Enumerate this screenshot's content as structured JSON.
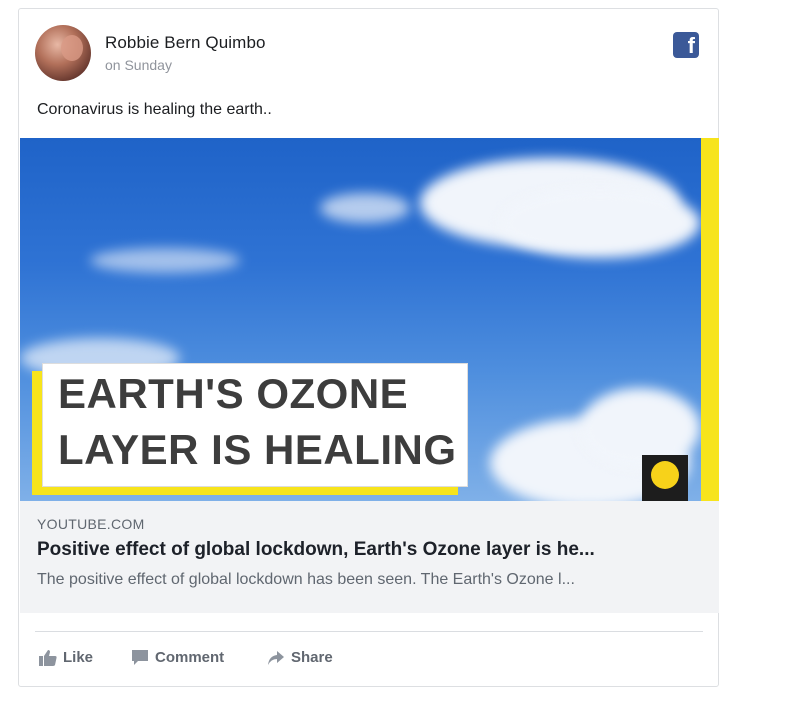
{
  "post": {
    "author": "Robbie Bern Quimbo",
    "time": "on Sunday",
    "message": "Coronavirus is healing the earth.."
  },
  "media": {
    "headline_line1": "EARTH'S OZONE",
    "headline_line2": "LAYER IS HEALING"
  },
  "link": {
    "domain": "YOUTUBE.COM",
    "title": "Positive effect of global lockdown, Earth's Ozone layer is he...",
    "description": "The positive effect of global lockdown has been seen. The Earth's Ozone l..."
  },
  "actions": {
    "like": "Like",
    "comment": "Comment",
    "share": "Share"
  },
  "icons": {
    "network": "facebook-icon",
    "like": "thumbs-up-icon",
    "comment": "comment-icon",
    "share": "share-arrow-icon"
  },
  "colors": {
    "facebook_blue": "#3b5998",
    "accent_yellow": "#f7e41c"
  }
}
